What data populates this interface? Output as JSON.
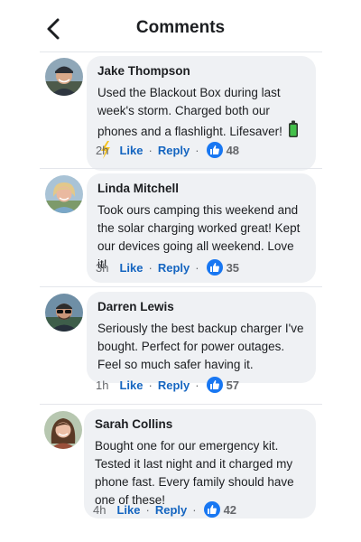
{
  "header": {
    "title": "Comments"
  },
  "comments": [
    {
      "author": "Jake Thompson",
      "text": "Used the Blackout Box during last week's storm. Charged both our phones and a flashlight. Lifesaver!",
      "emojis": [
        "battery-icon",
        "lightning-icon"
      ],
      "time": "2h",
      "like_label": "Like",
      "reply_label": "Reply",
      "separator": "·",
      "likes": "48"
    },
    {
      "author": "Linda Mitchell",
      "text": "Took ours camping this weekend and the solar charging worked great! Kept our devices going all weekend. Love it!",
      "time": "3h",
      "like_label": "Like",
      "reply_label": "Reply",
      "separator": "·",
      "likes": "35"
    },
    {
      "author": "Darren Lewis",
      "text": "Seriously the best backup charger I've bought. Perfect for power outages. Feel so much safer having it.",
      "time": "1h",
      "like_label": "Like",
      "reply_label": "Reply",
      "separator": "·",
      "likes": "57"
    },
    {
      "author": "Sarah Collins",
      "text": "Bought one for our emergency kit. Tested it last night and it charged my phone fast. Every family should have one of these!",
      "time": "4h",
      "like_label": "Like",
      "reply_label": "Reply",
      "separator": "·",
      "likes": "42"
    }
  ],
  "colors": {
    "accent": "#1877f2",
    "link": "#1565c0",
    "bubble": "#eff1f4"
  },
  "icons": {
    "back": "chevron-left-icon",
    "like": "thumbs-up-icon"
  }
}
